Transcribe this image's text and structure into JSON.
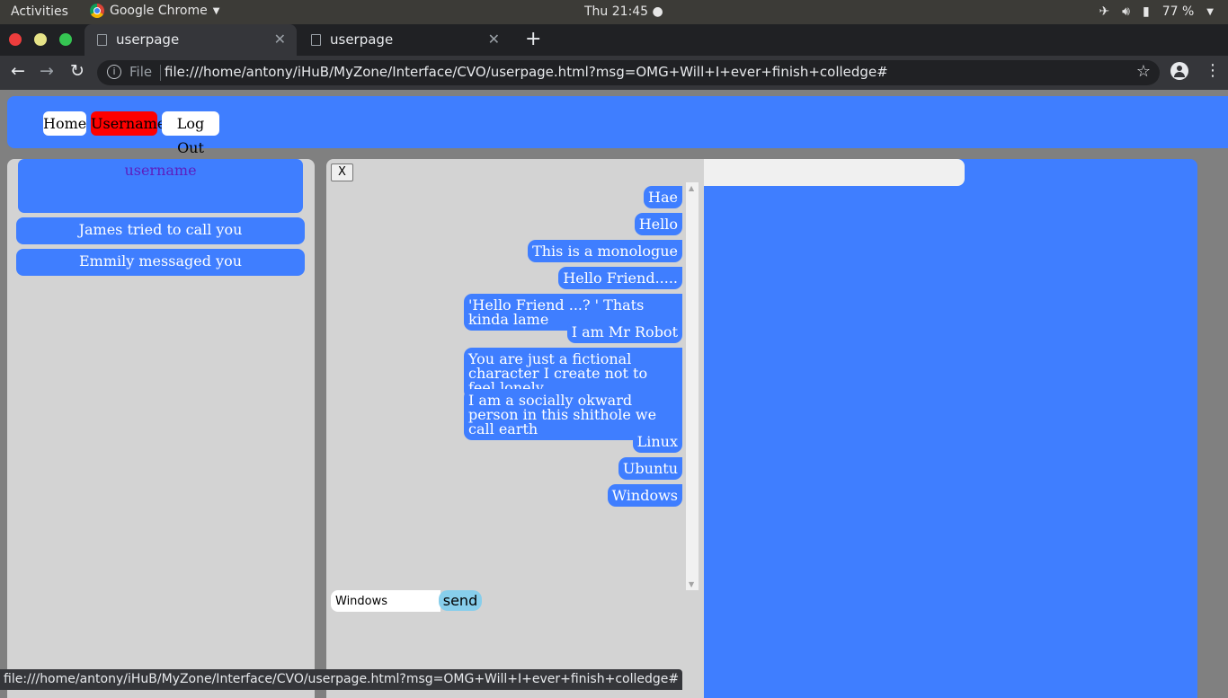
{
  "os_topbar": {
    "activities": "Activities",
    "app_name": "Google Chrome",
    "clock": "Thu 21:45 ●",
    "battery": "77 %"
  },
  "browser": {
    "tabs": [
      {
        "title": "userpage",
        "active": true
      },
      {
        "title": "userpage",
        "active": false
      }
    ],
    "omnibox": {
      "scheme_label": "File",
      "url": "file:///home/antony/iHuB/MyZone/Interface/CVO/userpage.html?msg=OMG+Will+I+ever+finish+colledge#"
    },
    "status_url": "file:///home/antony/iHuB/MyZone/Interface/CVO/userpage.html?msg=OMG+Will+I+ever+finish+colledge#"
  },
  "nav": {
    "home": "Home",
    "username": "Username",
    "logout": "Log Out"
  },
  "sidebar": {
    "username": "username",
    "notifications": [
      "James tried to call you",
      "Emmily messaged you"
    ]
  },
  "chat": {
    "close_label": "X",
    "messages": [
      "Hae",
      "Hello",
      "This is a monologue",
      "Hello Friend.....",
      "'Hello Friend ...? ' Thats kinda lame",
      "I am Mr Robot",
      "You are just a fictional character I create not to feel lonely",
      "I am a socially okward person in this shithole we call earth",
      "Linux",
      "Ubuntu",
      "Windows"
    ],
    "input_value": "Windows",
    "send_label": "send"
  },
  "colors": {
    "accent_blue": "#3f7eff",
    "active_nav": "#ff0000",
    "send_button": "#87ceeb",
    "panel_gray": "#d3d3d3"
  }
}
